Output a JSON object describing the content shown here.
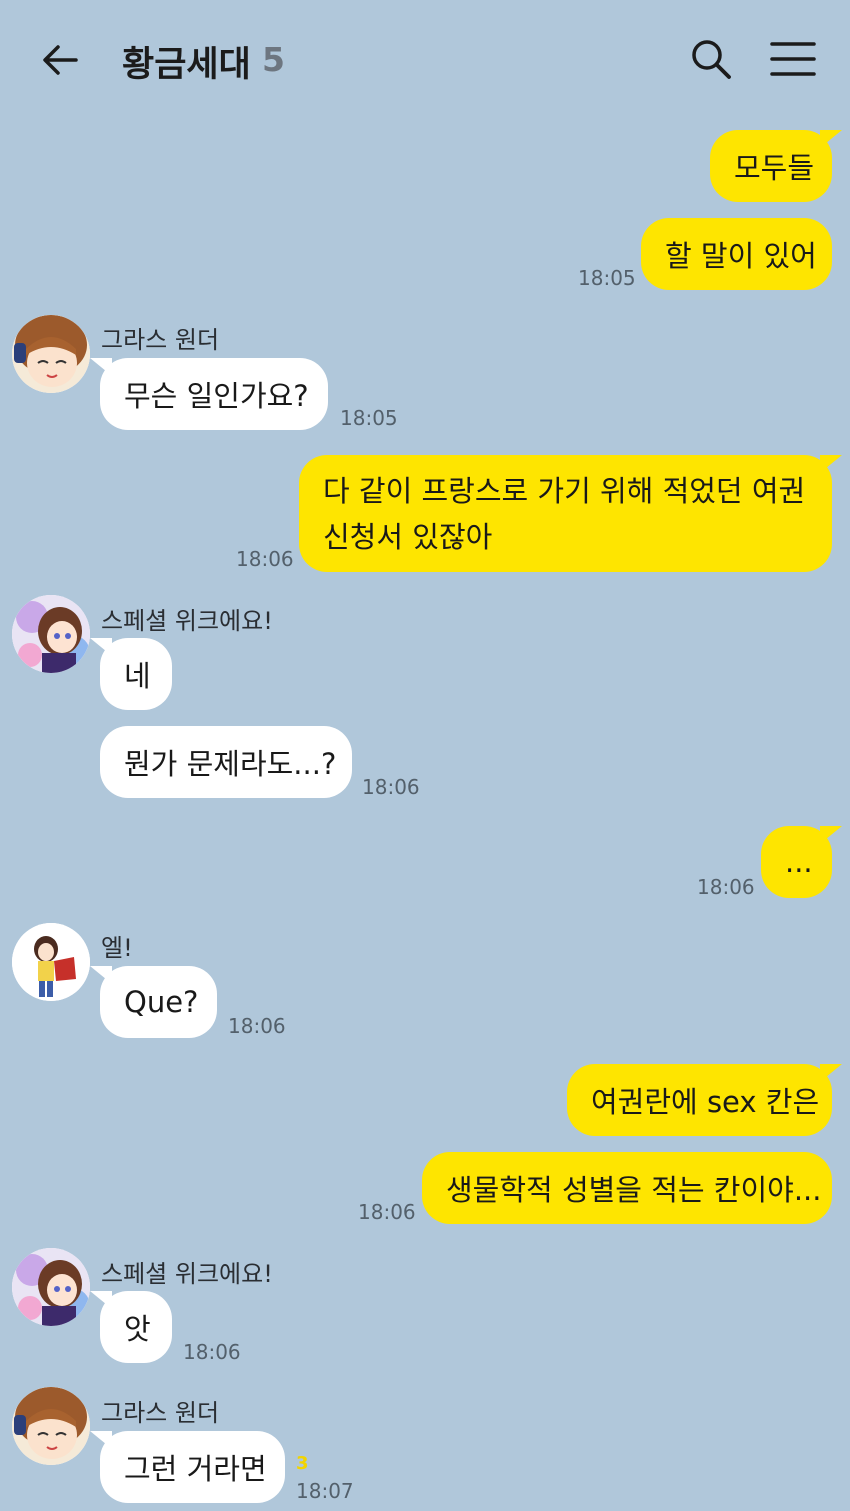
{
  "header": {
    "title": "황금세대",
    "member_count": "5"
  },
  "messages": [
    {
      "side": "mine",
      "text": "모두들"
    },
    {
      "side": "mine",
      "text": "할 말이 있어",
      "time": "18:05"
    },
    {
      "side": "theirs",
      "sender": "그라스 원더",
      "text": "무슨 일인가요?",
      "time": "18:05"
    },
    {
      "side": "mine",
      "text_line1": "다 같이 프랑스로 가기 위해 적었던 여권",
      "text_line2": "신청서 있잖아",
      "time": "18:06"
    },
    {
      "side": "theirs",
      "sender": "스페셜 위크에요!",
      "text": "네"
    },
    {
      "side": "theirs",
      "text": "뭔가 문제라도...?",
      "time": "18:06"
    },
    {
      "side": "mine",
      "text": "...",
      "time": "18:06"
    },
    {
      "side": "theirs",
      "sender": "엘!",
      "text": "Que?",
      "time": "18:06"
    },
    {
      "side": "mine",
      "text": "여권란에 sex 칸은"
    },
    {
      "side": "mine",
      "text": "생물학적 성별을 적는 칸이야...",
      "time": "18:06"
    },
    {
      "side": "theirs",
      "sender": "스페셜 위크에요!",
      "text": "앗",
      "time": "18:06"
    },
    {
      "side": "theirs",
      "sender": "그라스 원더",
      "text": "그런 거라면",
      "time": "18:07",
      "unread": "3"
    }
  ],
  "avatars": {
    "grass_wonder": "avatar-grass-wonder",
    "special_week": "avatar-special-week",
    "el": "avatar-el"
  },
  "colors": {
    "background": "#b0c7da",
    "my_bubble": "#fee500",
    "their_bubble": "#ffffff",
    "unread": "#f2d400"
  }
}
